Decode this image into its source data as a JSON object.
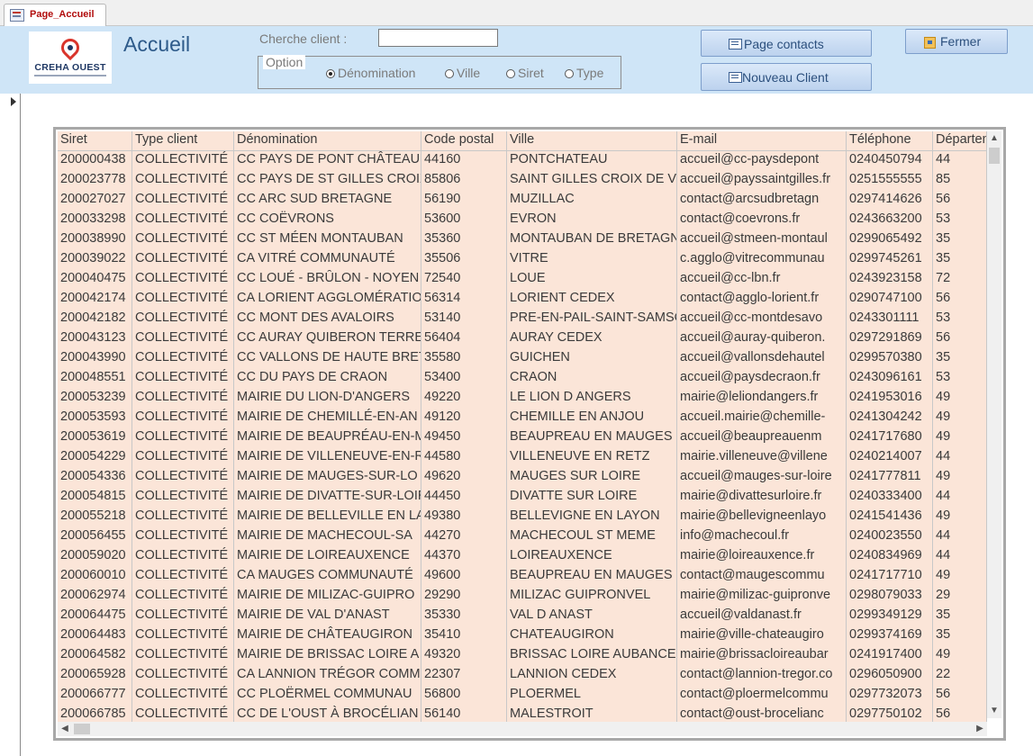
{
  "tab": {
    "label": "Page_Accueil",
    "icon": "form-icon"
  },
  "header": {
    "logo_text": "CREHA OUEST",
    "title": "Accueil",
    "search_label": "Cherche client :",
    "search_value": "",
    "option_legend": "Option",
    "options": [
      {
        "label": "Dénomination",
        "selected": true
      },
      {
        "label": "Ville",
        "selected": false
      },
      {
        "label": "Siret",
        "selected": false
      },
      {
        "label": "Type",
        "selected": false
      }
    ],
    "buttons": {
      "contacts": "Page contacts",
      "new_client": "Nouveau Client",
      "close": "Fermer"
    }
  },
  "table": {
    "columns": [
      "Siret",
      "Type client",
      "Dénomination",
      "Code postal",
      "Ville",
      "E-mail",
      "Téléphone",
      "Département"
    ],
    "rows": [
      [
        "200000438",
        "COLLECTIVITÉ",
        "CC PAYS DE PONT CHÂTEAU",
        "44160",
        "PONTCHATEAU",
        " accueil@cc-paysdepont",
        "0240450794",
        "44"
      ],
      [
        "200023778",
        "COLLECTIVITÉ",
        "CC PAYS DE ST GILLES CROIX",
        "85806",
        "SAINT GILLES CROIX DE VI",
        "accueil@payssaintgilles.fr",
        "0251555555",
        "85"
      ],
      [
        "200027027",
        "COLLECTIVITÉ",
        "CC ARC SUD BRETAGNE",
        "56190",
        "MUZILLAC",
        " contact@arcsudbretagn",
        "0297414626",
        "56"
      ],
      [
        "200033298",
        "COLLECTIVITÉ",
        "CC COËVRONS",
        "53600",
        "EVRON",
        "contact@coevrons.fr",
        "0243663200",
        "53"
      ],
      [
        "200038990",
        "COLLECTIVITÉ",
        "CC ST MÉEN MONTAUBAN",
        "35360",
        "MONTAUBAN DE BRETAGN",
        "accueil@stmeen-montaul",
        "0299065492",
        "35"
      ],
      [
        "200039022",
        "COLLECTIVITÉ",
        "CA VITRÉ COMMUNAUTÉ",
        "35506",
        "VITRE",
        "c.agglo@vitrecommunau",
        "0299745261",
        "35"
      ],
      [
        "200040475",
        "COLLECTIVITÉ",
        "CC LOUÉ - BRÛLON - NOYEN",
        "72540",
        "LOUE",
        "accueil@cc-lbn.fr",
        "0243923158",
        "72"
      ],
      [
        "200042174",
        "COLLECTIVITÉ",
        "CA LORIENT AGGLOMÉRATIO",
        "56314",
        "LORIENT CEDEX",
        " contact@agglo-lorient.fr",
        "0290747100",
        "56"
      ],
      [
        "200042182",
        "COLLECTIVITÉ",
        "CC MONT DES AVALOIRS",
        "53140",
        "PRE-EN-PAIL-SAINT-SAMSO",
        " accueil@cc-montdesavo",
        "0243301111",
        "53"
      ],
      [
        "200043123",
        "COLLECTIVITÉ",
        "CC AURAY QUIBERON TERRE",
        "56404",
        "AURAY CEDEX",
        "accueil@auray-quiberon.",
        "0297291869",
        "56"
      ],
      [
        "200043990",
        "COLLECTIVITÉ",
        "CC VALLONS DE HAUTE BRET",
        "35580",
        "GUICHEN",
        "accueil@vallonsdehautel",
        "0299570380",
        "35"
      ],
      [
        "200048551",
        "COLLECTIVITÉ",
        "CC DU PAYS DE CRAON",
        "53400",
        "CRAON",
        " accueil@paysdecraon.fr",
        "0243096161",
        "53"
      ],
      [
        "200053239",
        "COLLECTIVITÉ",
        "MAIRIE DU LION-D'ANGERS",
        "49220",
        "LE LION D ANGERS",
        "mairie@leliondangers.fr",
        "0241953016",
        "49"
      ],
      [
        "200053593",
        "COLLECTIVITÉ",
        "MAIRIE DE CHEMILLÉ-EN-AN",
        "49120",
        "CHEMILLE EN ANJOU",
        "accueil.mairie@chemille-",
        "0241304242",
        "49"
      ],
      [
        "200053619",
        "COLLECTIVITÉ",
        "MAIRIE DE BEAUPRÉAU-EN-M",
        "49450",
        "BEAUPREAU EN MAUGES",
        "accueil@beaupreauenm",
        "0241717680",
        "49"
      ],
      [
        "200054229",
        "COLLECTIVITÉ",
        "MAIRIE DE VILLENEUVE-EN-R",
        "44580",
        "VILLENEUVE EN RETZ",
        "mairie.villeneuve@villene",
        "0240214007",
        "44"
      ],
      [
        "200054336",
        "COLLECTIVITÉ",
        "MAIRIE DE MAUGES-SUR-LO",
        "49620",
        "MAUGES SUR LOIRE",
        "accueil@mauges-sur-loire",
        "0241777811",
        "49"
      ],
      [
        "200054815",
        "COLLECTIVITÉ",
        "MAIRIE DE DIVATTE-SUR-LOIR",
        "44450",
        "DIVATTE SUR LOIRE",
        "mairie@divattesurloire.fr",
        "0240333400",
        "44"
      ],
      [
        "200055218",
        "COLLECTIVITÉ",
        "MAIRIE DE BELLEVILLE EN LA",
        "49380",
        "BELLEVIGNE EN LAYON",
        "mairie@bellevigneenlayo",
        "0241541436",
        "49"
      ],
      [
        "200056455",
        "COLLECTIVITÉ",
        "MAIRIE DE MACHECOUL-SA",
        "44270",
        "MACHECOUL ST MEME",
        "info@machecoul.fr",
        "0240023550",
        "44"
      ],
      [
        "200059020",
        "COLLECTIVITÉ",
        "MAIRIE DE LOIREAUXENCE",
        "44370",
        "LOIREAUXENCE",
        "mairie@loireauxence.fr",
        "0240834969",
        "44"
      ],
      [
        "200060010",
        "COLLECTIVITÉ",
        "CA MAUGES COMMUNAUTÉ",
        "49600",
        "BEAUPREAU EN MAUGES",
        "contact@maugescommu",
        "0241717710",
        "49"
      ],
      [
        "200062974",
        "COLLECTIVITÉ",
        "MAIRIE DE MILIZAC-GUIPRO",
        "29290",
        "MILIZAC GUIPRONVEL",
        "mairie@milizac-guipronve",
        "0298079033",
        "29"
      ],
      [
        "200064475",
        "COLLECTIVITÉ",
        "MAIRIE DE VAL D'ANAST",
        "35330",
        "VAL D ANAST",
        "accueil@valdanast.fr",
        "0299349129",
        "35"
      ],
      [
        "200064483",
        "COLLECTIVITÉ",
        "MAIRIE DE CHÂTEAUGIRON",
        "35410",
        "CHATEAUGIRON",
        "mairie@ville-chateaugiro",
        "0299374169",
        "35"
      ],
      [
        "200064582",
        "COLLECTIVITÉ",
        "MAIRIE DE BRISSAC LOIRE A",
        "49320",
        "BRISSAC LOIRE AUBANCE",
        "mairie@brissacloireaubar",
        "0241917400",
        "49"
      ],
      [
        "200065928",
        "COLLECTIVITÉ",
        "CA LANNION TRÉGOR COMM",
        "22307",
        "LANNION CEDEX",
        "contact@lannion-tregor.co",
        "0296050900",
        "22"
      ],
      [
        "200066777",
        "COLLECTIVITÉ",
        "CC PLOËRMEL COMMUNAU",
        "56800",
        "PLOERMEL",
        "contact@ploermelcommu",
        "0297732073",
        "56"
      ],
      [
        "200066785",
        "COLLECTIVITÉ",
        "CC DE L'OUST À BROCÉLIAN",
        "56140",
        "MALESTROIT",
        " contact@oust-brocelianc",
        "0297750102",
        "56"
      ]
    ]
  }
}
